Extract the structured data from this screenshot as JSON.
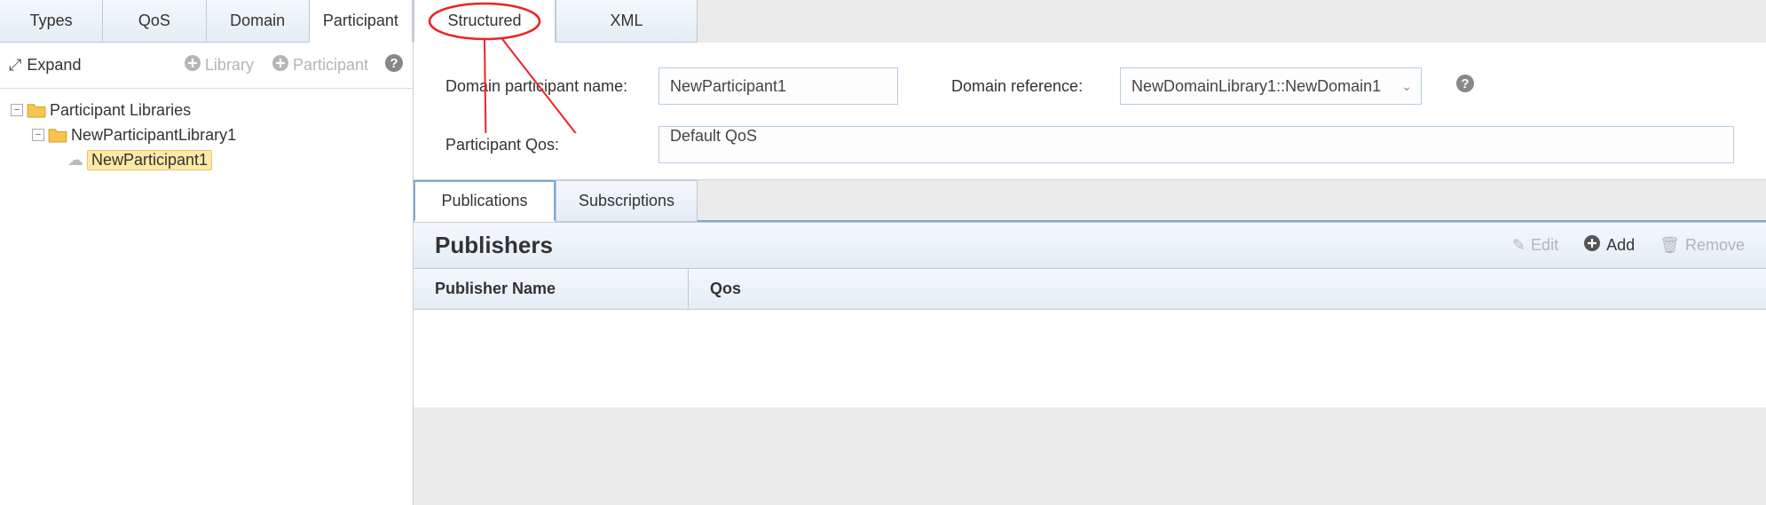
{
  "left_tabs": {
    "types": "Types",
    "qos": "QoS",
    "domain": "Domain",
    "participant": "Participant"
  },
  "toolbar": {
    "expand": "Expand",
    "library": "Library",
    "add_participant": "Participant"
  },
  "tree": {
    "root": "Participant Libraries",
    "lib": "NewParticipantLibrary1",
    "participant": "NewParticipant1"
  },
  "right_tabs": {
    "structured": "Structured",
    "xml": "XML"
  },
  "form": {
    "name_label": "Domain participant name:",
    "name_value": "NewParticipant1",
    "dref_label": "Domain reference:",
    "dref_value": "NewDomainLibrary1::NewDomain1",
    "qos_label": "Participant Qos:",
    "qos_value": "Default QoS"
  },
  "subtabs": {
    "publications": "Publications",
    "subscriptions": "Subscriptions"
  },
  "publishers": {
    "title": "Publishers",
    "edit": "Edit",
    "add": "Add",
    "remove": "Remove",
    "col_name": "Publisher Name",
    "col_qos": "Qos"
  }
}
